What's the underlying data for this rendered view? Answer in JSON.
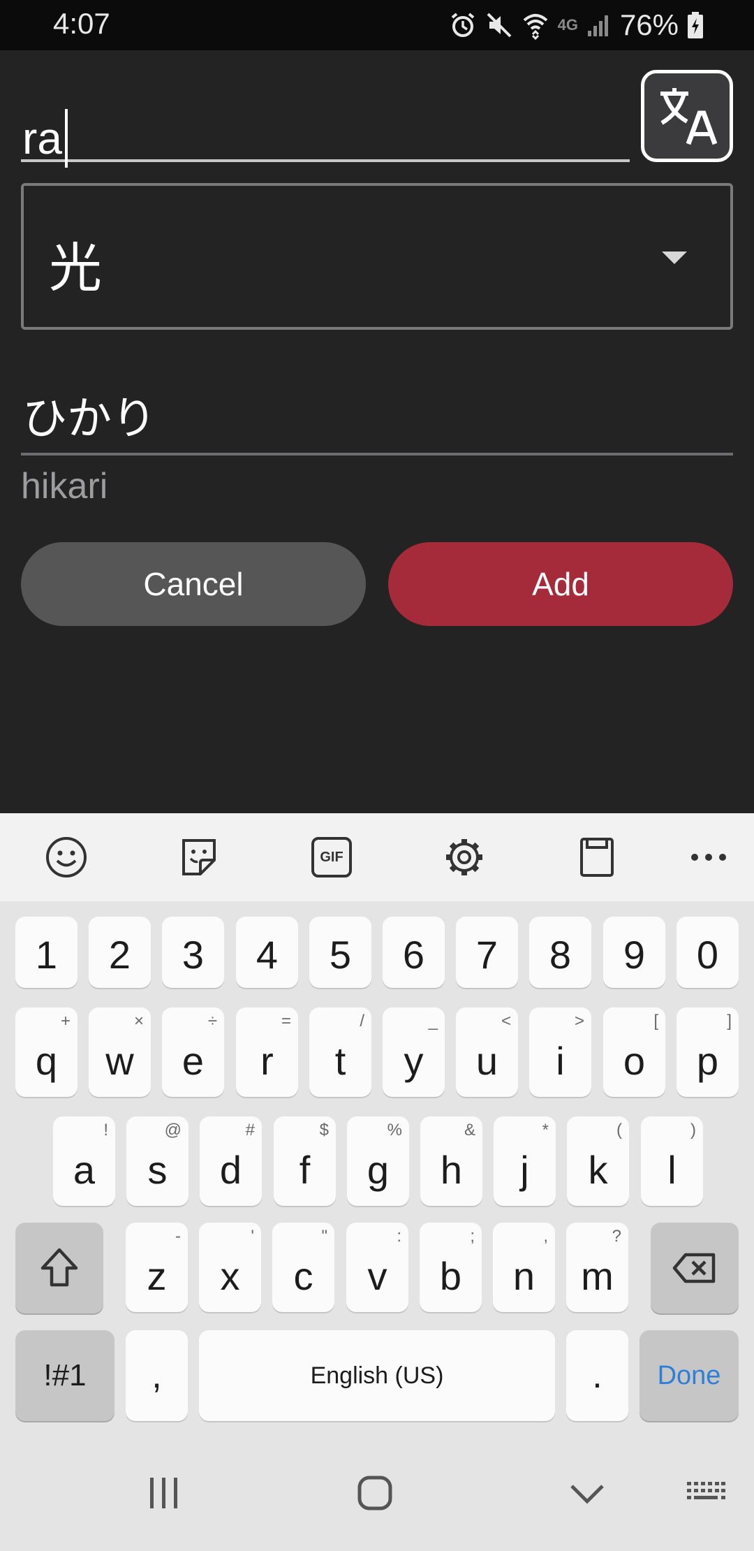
{
  "status_bar": {
    "time": "4:07",
    "battery_percent": "76%",
    "icons": [
      "alarm-icon",
      "mute-icon",
      "wifi-icon",
      "lte-icon",
      "signal-icon",
      "battery-icon"
    ],
    "network_label": "4G"
  },
  "form": {
    "input_value": "ra",
    "kanji_selected": "光",
    "reading": "ひかり",
    "romaji": "hikari",
    "cancel_label": "Cancel",
    "add_label": "Add",
    "translate_icon": "translate-icon"
  },
  "keyboard": {
    "toolbar": [
      "emoji-icon",
      "sticker-icon",
      "gif-icon",
      "settings-icon",
      "clipboard-icon",
      "more-icon"
    ],
    "gif_label": "GIF",
    "numbers": [
      "1",
      "2",
      "3",
      "4",
      "5",
      "6",
      "7",
      "8",
      "9",
      "0"
    ],
    "row1": [
      {
        "key": "q",
        "alt": "+"
      },
      {
        "key": "w",
        "alt": "×"
      },
      {
        "key": "e",
        "alt": "÷"
      },
      {
        "key": "r",
        "alt": "="
      },
      {
        "key": "t",
        "alt": "/"
      },
      {
        "key": "y",
        "alt": "_"
      },
      {
        "key": "u",
        "alt": "<"
      },
      {
        "key": "i",
        "alt": ">"
      },
      {
        "key": "o",
        "alt": "["
      },
      {
        "key": "p",
        "alt": "]"
      }
    ],
    "row2": [
      {
        "key": "a",
        "alt": "!"
      },
      {
        "key": "s",
        "alt": "@"
      },
      {
        "key": "d",
        "alt": "#"
      },
      {
        "key": "f",
        "alt": "$"
      },
      {
        "key": "g",
        "alt": "%"
      },
      {
        "key": "h",
        "alt": "&"
      },
      {
        "key": "j",
        "alt": "*"
      },
      {
        "key": "k",
        "alt": "("
      },
      {
        "key": "l",
        "alt": ")"
      }
    ],
    "row3": [
      {
        "key": "z",
        "alt": "-"
      },
      {
        "key": "x",
        "alt": "'"
      },
      {
        "key": "c",
        "alt": "\""
      },
      {
        "key": "v",
        "alt": ":"
      },
      {
        "key": "b",
        "alt": ";"
      },
      {
        "key": "n",
        "alt": ","
      },
      {
        "key": "m",
        "alt": "?"
      }
    ],
    "symbols_label": "!#1",
    "comma_label": ",",
    "space_label": "English (US)",
    "period_label": ".",
    "done_label": "Done",
    "done_color": "#2e7fd8"
  },
  "navbar": [
    "recent-apps-icon",
    "home-icon",
    "back-icon",
    "keyboard-switch-icon"
  ],
  "colors": {
    "add_button": "#a62b3a",
    "cancel_button": "#565657",
    "background": "#232324"
  }
}
